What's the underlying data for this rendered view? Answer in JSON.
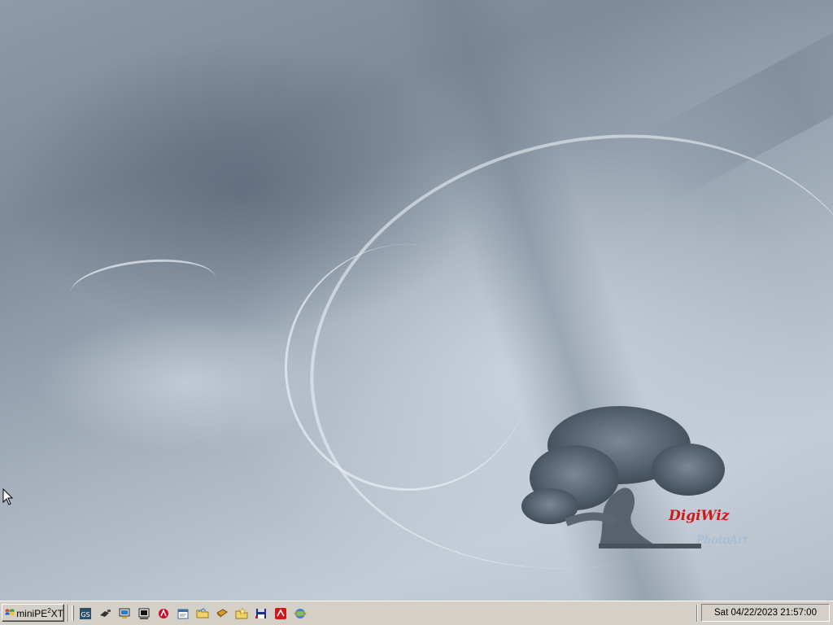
{
  "desktop": {
    "logo": {
      "brand": "DigiWiz",
      "sub": "PhotoArt"
    }
  },
  "taskbar": {
    "start_label_pre": "miniPE",
    "start_label_sup": "2",
    "start_label_post": "XT",
    "quick_launch": [
      {
        "icon": "gs-icon",
        "label": "GS"
      },
      {
        "icon": "plug-icon"
      },
      {
        "icon": "my-computer-icon"
      },
      {
        "icon": "terminal-icon"
      },
      {
        "icon": "acrobat-icon"
      },
      {
        "icon": "notepad-icon"
      },
      {
        "icon": "folder-icon"
      },
      {
        "icon": "disk-tool-icon"
      },
      {
        "icon": "star-folder-icon"
      },
      {
        "icon": "floppy-icon"
      },
      {
        "icon": "red-app-icon"
      },
      {
        "icon": "internet-icon"
      }
    ],
    "clock": "Sat 04/22/2023 21:57:00"
  }
}
